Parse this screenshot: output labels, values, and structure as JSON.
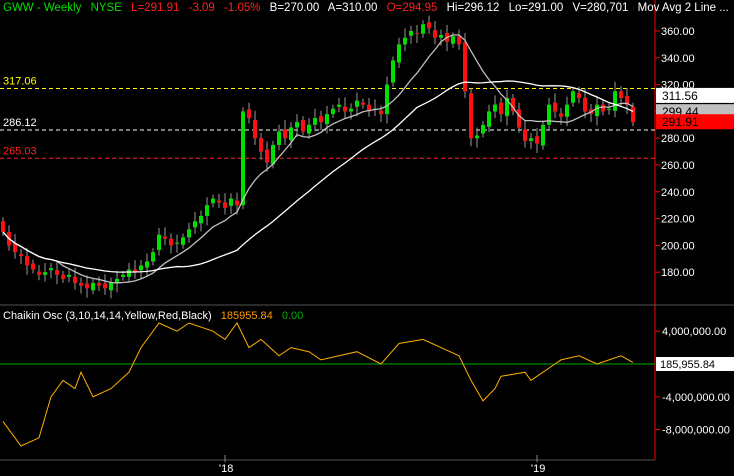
{
  "header": {
    "symbol": "GWW - Weekly",
    "exchange": "NYSE",
    "last": "L=291.91",
    "change": "-3.09",
    "pct": "-1.05%",
    "bid": "B=270.00",
    "ask": "A=310.00",
    "open": "O=294.95",
    "high": "Hi=296.12",
    "low": "Lo=291.00",
    "volume": "V=280,701",
    "study": "Mov Avg 2 Line ..."
  },
  "indicator": {
    "title": "Chaikin Osc (3,10,14,14,Yellow,Red,Black)",
    "value": "185955.84",
    "value2": "0.00"
  },
  "colors": {
    "up": "#00e000",
    "down": "#ff1010",
    "ma_fast": "#c0c0c0",
    "ma_slow": "#ffffff",
    "osc": "#ffb000",
    "zero": "#00b000",
    "axis": "#ff0000"
  },
  "chart_data": [
    {
      "type": "candlestick",
      "title": "GWW - Weekly",
      "ylim": [
        170,
        375
      ],
      "yticks": [
        "360.00",
        "340.00",
        "320.00",
        "300.00",
        "280.00",
        "260.00",
        "240.00",
        "220.00",
        "200.00",
        "180.00"
      ],
      "xticks": [
        {
          "label": "'18",
          "index": 37
        },
        {
          "label": "'19",
          "index": 89
        }
      ],
      "hlines": [
        {
          "value": 317.06,
          "label": "317.06",
          "color": "#ffff00"
        },
        {
          "value": 286.12,
          "label": "286.12",
          "color": "#ffffff"
        },
        {
          "value": 265.03,
          "label": "265.03",
          "color": "#ff2020"
        }
      ],
      "price_labels": [
        {
          "value": 311.56,
          "label": "311.56",
          "bg": "#ffffff",
          "fg": "#000"
        },
        {
          "value": 299.44,
          "label": "299.44",
          "bg": "#c0c0c0",
          "fg": "#000"
        },
        {
          "value": 291.91,
          "label": "291.91",
          "bg": "#ff0000",
          "fg": "#000"
        }
      ],
      "closes": [
        210,
        200,
        195,
        192,
        185,
        182,
        178,
        180,
        183,
        178,
        175,
        178,
        172,
        170,
        168,
        172,
        170,
        168,
        172,
        175,
        178,
        182,
        180,
        185,
        188,
        195,
        208,
        205,
        200,
        202,
        206,
        212,
        218,
        222,
        230,
        235,
        232,
        228,
        235,
        230,
        300,
        295,
        280,
        270,
        262,
        275,
        285,
        280,
        288,
        292,
        285,
        290,
        295,
        292,
        298,
        302,
        305,
        300,
        302,
        308,
        305,
        300,
        302,
        298,
        320,
        338,
        350,
        355,
        360,
        358,
        365,
        362,
        355,
        357,
        352,
        356,
        350,
        315,
        280,
        282,
        290,
        300,
        305,
        298,
        310,
        300,
        288,
        278,
        280,
        276,
        290,
        305,
        300,
        296,
        305,
        315,
        310,
        300,
        298,
        305,
        300,
        302,
        315,
        310,
        305,
        291.91
      ],
      "ma_periods": [
        10,
        30
      ]
    },
    {
      "type": "line",
      "title": "Chaikin Osc",
      "ylim": [
        -11000000,
        6000000
      ],
      "yticks": [
        {
          "value": 4000000,
          "label": "4,000,000.00"
        },
        {
          "value": -4000000,
          "label": "-4,000,000.00"
        },
        {
          "value": -8000000,
          "label": "-8,000,000.00"
        }
      ],
      "last_label": "185,955.84",
      "points": [
        [
          0,
          -7000000
        ],
        [
          3,
          -10000000
        ],
        [
          6,
          -9000000
        ],
        [
          8,
          -4000000
        ],
        [
          10,
          -2000000
        ],
        [
          12,
          -3000000
        ],
        [
          13,
          -1000000
        ],
        [
          15,
          -4000000
        ],
        [
          18,
          -3000000
        ],
        [
          21,
          -1000000
        ],
        [
          23,
          2000000
        ],
        [
          26,
          5000000
        ],
        [
          29,
          4000000
        ],
        [
          31,
          5000000
        ],
        [
          35,
          4000000
        ],
        [
          37,
          3000000
        ],
        [
          39,
          5000000
        ],
        [
          41,
          2000000
        ],
        [
          43,
          3000000
        ],
        [
          46,
          1000000
        ],
        [
          48,
          2000000
        ],
        [
          51,
          1500000
        ],
        [
          53,
          500000
        ],
        [
          56,
          1000000
        ],
        [
          59,
          1500000
        ],
        [
          63,
          0
        ],
        [
          66,
          2500000
        ],
        [
          70,
          3000000
        ],
        [
          73,
          2000000
        ],
        [
          76,
          1000000
        ],
        [
          78,
          -2000000
        ],
        [
          80,
          -4500000
        ],
        [
          82,
          -3000000
        ],
        [
          83,
          -1500000
        ],
        [
          87,
          -1000000
        ],
        [
          88,
          -2000000
        ],
        [
          90,
          -1000000
        ],
        [
          92,
          0
        ],
        [
          93,
          500000
        ],
        [
          96,
          1000000
        ],
        [
          99,
          0
        ],
        [
          101,
          500000
        ],
        [
          103,
          1000000
        ],
        [
          105,
          185955.84
        ]
      ]
    }
  ]
}
